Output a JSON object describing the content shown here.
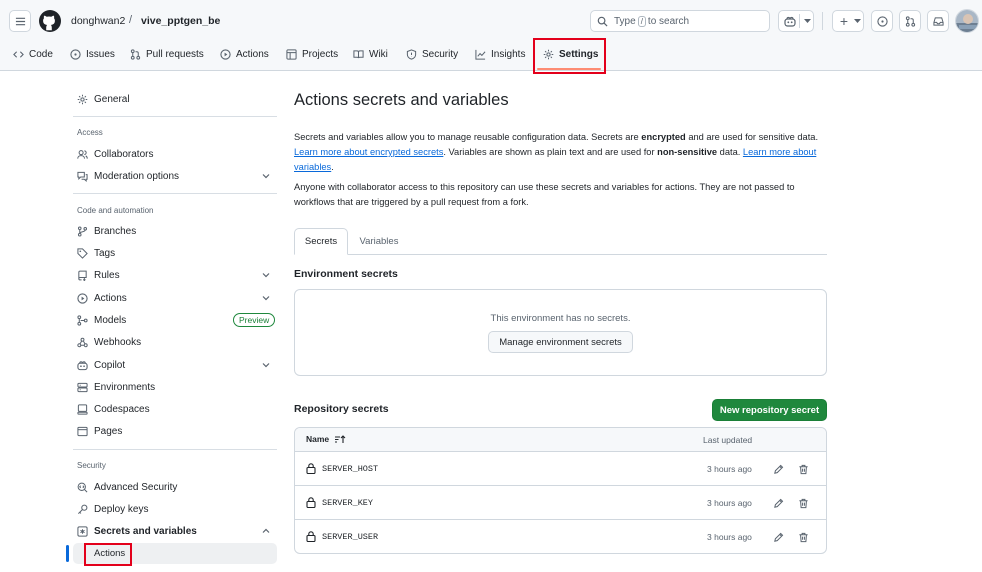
{
  "header": {
    "owner": "donghwan2",
    "separator": "/",
    "repo": "vive_pptgen_be",
    "search_prefix": "Type",
    "search_key": "/",
    "search_suffix": "to search",
    "plus_label": "+"
  },
  "repo_tabs": [
    {
      "label": "Code",
      "icon": "code-icon"
    },
    {
      "label": "Issues",
      "icon": "issue-icon"
    },
    {
      "label": "Pull requests",
      "icon": "pull-request-icon"
    },
    {
      "label": "Actions",
      "icon": "play-icon"
    },
    {
      "label": "Projects",
      "icon": "table-icon"
    },
    {
      "label": "Wiki",
      "icon": "book-icon"
    },
    {
      "label": "Security",
      "icon": "shield-icon"
    },
    {
      "label": "Insights",
      "icon": "graph-icon"
    },
    {
      "label": "Settings",
      "icon": "gear-icon",
      "selected": true
    }
  ],
  "sidebar": {
    "general": "General",
    "access_heading": "Access",
    "collaborators": "Collaborators",
    "moderation": "Moderation options",
    "code_heading": "Code and automation",
    "branches": "Branches",
    "tags": "Tags",
    "rules": "Rules",
    "actions": "Actions",
    "models": "Models",
    "models_badge": "Preview",
    "webhooks": "Webhooks",
    "copilot": "Copilot",
    "environments": "Environments",
    "codespaces": "Codespaces",
    "pages": "Pages",
    "security_heading": "Security",
    "advanced_security": "Advanced Security",
    "deploy_keys": "Deploy keys",
    "secrets_vars": "Secrets and variables",
    "sub_actions": "Actions"
  },
  "main": {
    "title": "Actions secrets and variables",
    "p1_a": "Secrets and variables allow you to manage reusable configuration data. Secrets are ",
    "p1_b": "encrypted",
    "p1_c": " and are used for sensitive data. ",
    "p1_link1": "Learn more about encrypted secrets",
    "p1_d": ". Variables are shown as plain text and are used for ",
    "p1_e": "non-sensitive",
    "p1_f": " data. ",
    "p1_link2": "Learn more about variables",
    "p1_g": ".",
    "p2": "Anyone with collaborator access to this repository can use these secrets and variables for actions. They are not passed to workflows that are triggered by a pull request from a fork.",
    "tab_secrets": "Secrets",
    "tab_variables": "Variables",
    "env_heading": "Environment secrets",
    "env_empty": "This environment has no secrets.",
    "env_button": "Manage environment secrets",
    "repo_heading": "Repository secrets",
    "new_button": "New repository secret",
    "col_name": "Name",
    "col_updated": "Last updated",
    "secrets": [
      {
        "name": "SERVER_HOST",
        "updated": "3 hours ago"
      },
      {
        "name": "SERVER_KEY",
        "updated": "3 hours ago"
      },
      {
        "name": "SERVER_USER",
        "updated": "3 hours ago"
      }
    ]
  },
  "colors": {
    "green": "#1f883d",
    "link": "#0969da",
    "highlight_red": "#e3001b",
    "selected_tab_underline": "#fd8c73"
  }
}
